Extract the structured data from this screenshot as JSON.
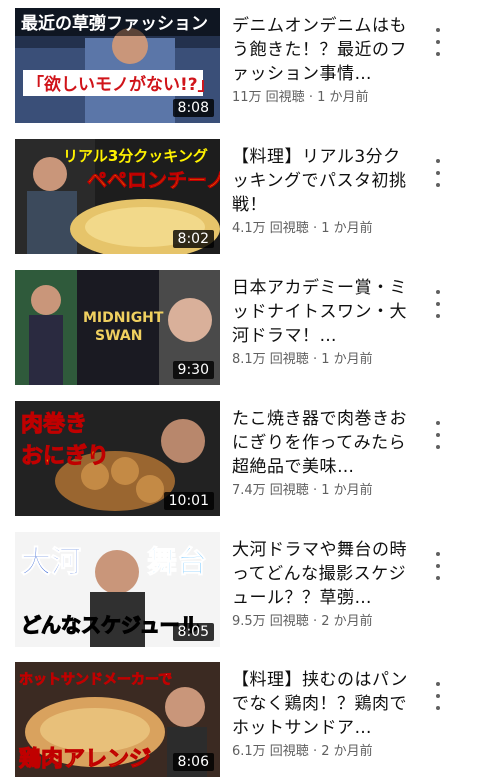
{
  "videos": [
    {
      "title": "デニムオンデニムはもう飽きた！？最近のファッション事情…",
      "views": "11万 回視聴",
      "age": "1 か月前",
      "duration": "8:08",
      "thumb_text": [
        "最近の草彅ファッション",
        "「欲しいモノがない!?」"
      ]
    },
    {
      "title": "【料理】リアル3分クッキングでパスタ初挑戦！",
      "views": "4.1万 回視聴",
      "age": "1 か月前",
      "duration": "8:02",
      "thumb_text": [
        "リアル3分クッキング",
        "ペペロンチーノ"
      ]
    },
    {
      "title": "日本アカデミー賞・ミッドナイトスワン・大河ドラマ！…",
      "views": "8.1万 回視聴",
      "age": "1 か月前",
      "duration": "9:30",
      "thumb_text": [
        "MIDNIGHT",
        "SWAN"
      ]
    },
    {
      "title": "たこ焼き器で肉巻きおにぎりを作ってみたら超絶品で美味…",
      "views": "7.4万 回視聴",
      "age": "1 か月前",
      "duration": "10:01",
      "thumb_text": [
        "肉巻き",
        "おにぎり"
      ]
    },
    {
      "title": "大河ドラマや舞台の時ってどんな撮影スケジュール？？草彅…",
      "views": "9.5万 回視聴",
      "age": "2 か月前",
      "duration": "8:05",
      "thumb_text": [
        "大河",
        "舞台",
        "どんなスケジュール"
      ]
    },
    {
      "title": "【料理】挟むのはパンでなく鶏肉！？鶏肉でホットサンドア…",
      "views": "6.1万 回視聴",
      "age": "2 か月前",
      "duration": "8:06",
      "thumb_text": [
        "ホットサンドメーカーで",
        "鶏肉アレンジ"
      ]
    }
  ],
  "icons": {
    "more": "more-vert-icon"
  }
}
